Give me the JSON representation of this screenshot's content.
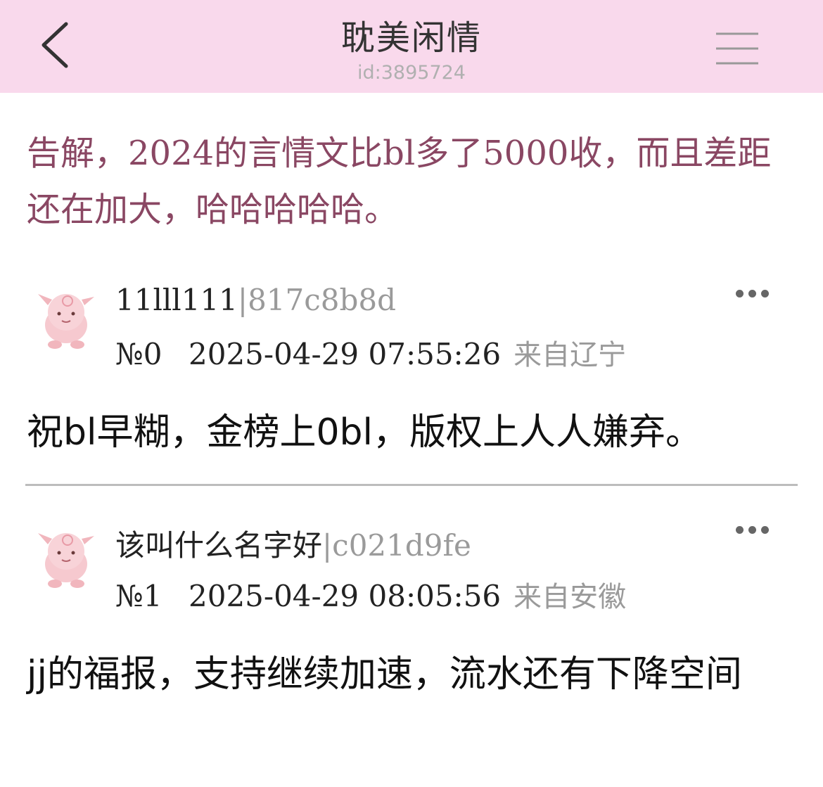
{
  "header": {
    "title": "耽美闲情",
    "subtitle": "id:3895724",
    "background_color": "#f9d9ec",
    "back_icon": "chevron-left-icon",
    "menu_icon": "menu-lines-icon"
  },
  "post": {
    "title": "告解，2024的言情文比bl多了5000收，而且差距还在加大，哈哈哈哈哈。",
    "title_color": "#8a4763"
  },
  "replies": [
    {
      "author_name": "11lll111",
      "separator": "|",
      "author_id": "817c8b8d",
      "floor": "№0",
      "time": "2025-04-29 07:55:26",
      "location": "来自辽宁",
      "content": "祝bl早糊，金榜上0bl，版权上人人嫌弃。",
      "avatar_icon": "pink-pokemon-avatar-icon"
    },
    {
      "author_name": "该叫什么名字好",
      "separator": "|",
      "author_id": "c021d9fe",
      "floor": "№1",
      "time": "2025-04-29 08:05:56",
      "location": "来自安徽",
      "content": "jj的福报，支持继续加速，流水还有下降空间",
      "avatar_icon": "pink-pokemon-avatar-icon"
    }
  ]
}
